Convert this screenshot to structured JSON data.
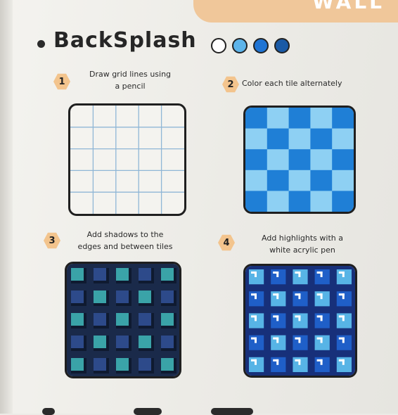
{
  "header": {
    "wall_label": "WALL"
  },
  "section": {
    "title": "BackSplash"
  },
  "swatches": [
    {
      "color": "#ffffff"
    },
    {
      "color": "#5db4ea"
    },
    {
      "color": "#1f74d4"
    },
    {
      "color": "#1a5aa6"
    }
  ],
  "steps": [
    {
      "number": "1",
      "text_line1": "Draw grid lines using",
      "text_line2": "a pencil"
    },
    {
      "number": "2",
      "text_line1": "Color each tile alternately",
      "text_line2": ""
    },
    {
      "number": "3",
      "text_line1": "Add shadows to the",
      "text_line2": "edges and between tiles"
    },
    {
      "number": "4",
      "text_line1": "Add highlights with a",
      "text_line2": "white acrylic pen"
    }
  ],
  "colors": {
    "grid_line": "#8fb6d6",
    "checker_light": "#8ed0f3",
    "checker_dark": "#1f7fd6",
    "shadow_bg": "#1a2a4a",
    "shadow_tile": "#2d4a8a",
    "shadow_accent": "#3aa3a8",
    "highlight_bg": "#17307a",
    "highlight_tile": "#1f5fc8",
    "highlight_light": "#57b4e6"
  }
}
